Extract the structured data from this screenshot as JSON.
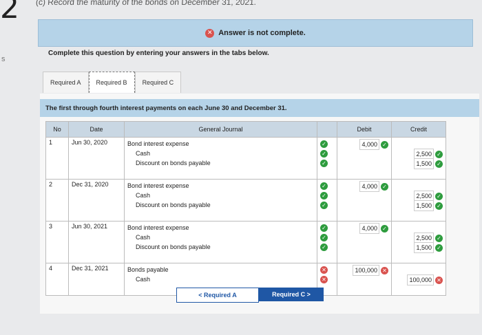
{
  "page": {
    "question_number": "2",
    "edge_mark": "s",
    "top_line": "(c) Record the maturity of the bonds on December 31, 2021."
  },
  "banner": {
    "text": "Answer is not complete."
  },
  "instructions": "Complete this question by entering your answers in the tabs below.",
  "tabs": [
    {
      "label": "Required A"
    },
    {
      "label": "Required B"
    },
    {
      "label": "Required C"
    }
  ],
  "subtitle": "The first through fourth interest payments on each June 30 and December 31.",
  "table": {
    "headers": {
      "no": "No",
      "date": "Date",
      "journal": "General Journal",
      "debit": "Debit",
      "credit": "Credit"
    },
    "rows": [
      {
        "no": "1",
        "date": "Jun 30, 2020",
        "lines": [
          {
            "account": "Bond interest expense",
            "indent": false,
            "debit": "4,000",
            "credit": "",
            "ok": true
          },
          {
            "account": "Cash",
            "indent": true,
            "debit": "",
            "credit": "2,500",
            "ok": true
          },
          {
            "account": "Discount on bonds payable",
            "indent": true,
            "debit": "",
            "credit": "1,500",
            "ok": true
          }
        ]
      },
      {
        "no": "2",
        "date": "Dec 31, 2020",
        "lines": [
          {
            "account": "Bond interest expense",
            "indent": false,
            "debit": "4,000",
            "credit": "",
            "ok": true
          },
          {
            "account": "Cash",
            "indent": true,
            "debit": "",
            "credit": "2,500",
            "ok": true
          },
          {
            "account": "Discount on bonds payable",
            "indent": true,
            "debit": "",
            "credit": "1,500",
            "ok": true
          }
        ]
      },
      {
        "no": "3",
        "date": "Jun 30, 2021",
        "lines": [
          {
            "account": "Bond interest expense",
            "indent": false,
            "debit": "4,000",
            "credit": "",
            "ok": true
          },
          {
            "account": "Cash",
            "indent": true,
            "debit": "",
            "credit": "2,500",
            "ok": true
          },
          {
            "account": "Discount on bonds payable",
            "indent": true,
            "debit": "",
            "credit": "1,500",
            "ok": true
          }
        ]
      },
      {
        "no": "4",
        "date": "Dec 31, 2021",
        "lines": [
          {
            "account": "Bonds payable",
            "indent": false,
            "debit": "100,000",
            "credit": "",
            "ok": false
          },
          {
            "account": "Cash",
            "indent": true,
            "debit": "",
            "credit": "100,000",
            "ok": false
          }
        ]
      }
    ]
  },
  "nav": {
    "prev": "Required A",
    "next": "Required C"
  },
  "colors": {
    "accent": "#1f57a5",
    "correct": "#2e9c3e",
    "incorrect": "#d9534f",
    "banner": "#b5d3e8"
  }
}
